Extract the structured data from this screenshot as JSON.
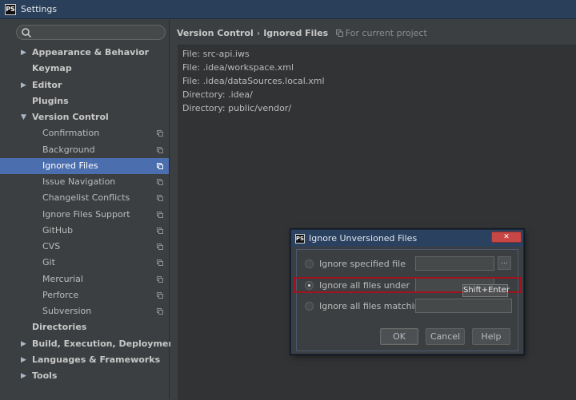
{
  "window": {
    "title": "Settings",
    "logo_text": "PS"
  },
  "search": {
    "placeholder": "",
    "value": ""
  },
  "sidebar": {
    "items": [
      {
        "label": "Appearance & Behavior",
        "level": 1,
        "expandable": true,
        "expanded": false,
        "bold": true
      },
      {
        "label": "Keymap",
        "level": 1,
        "expandable": false,
        "bold": true
      },
      {
        "label": "Editor",
        "level": 1,
        "expandable": true,
        "expanded": false,
        "bold": true
      },
      {
        "label": "Plugins",
        "level": 1,
        "expandable": false,
        "bold": true
      },
      {
        "label": "Version Control",
        "level": 1,
        "expandable": true,
        "expanded": true,
        "bold": true
      },
      {
        "label": "Confirmation",
        "level": 2,
        "copy": true
      },
      {
        "label": "Background",
        "level": 2,
        "copy": true
      },
      {
        "label": "Ignored Files",
        "level": 2,
        "copy": true,
        "selected": true
      },
      {
        "label": "Issue Navigation",
        "level": 2,
        "copy": true
      },
      {
        "label": "Changelist Conflicts",
        "level": 2,
        "copy": true
      },
      {
        "label": "Ignore Files Support",
        "level": 2,
        "copy": true
      },
      {
        "label": "GitHub",
        "level": 2,
        "copy": true
      },
      {
        "label": "CVS",
        "level": 2,
        "copy": true
      },
      {
        "label": "Git",
        "level": 2,
        "copy": true
      },
      {
        "label": "Mercurial",
        "level": 2,
        "copy": true
      },
      {
        "label": "Perforce",
        "level": 2,
        "copy": true
      },
      {
        "label": "Subversion",
        "level": 2,
        "copy": true
      },
      {
        "label": "Directories",
        "level": 1,
        "expandable": false,
        "bold": true
      },
      {
        "label": "Build, Execution, Deployment",
        "level": 1,
        "expandable": true,
        "expanded": false,
        "bold": true
      },
      {
        "label": "Languages & Frameworks",
        "level": 1,
        "expandable": true,
        "expanded": false,
        "bold": true
      },
      {
        "label": "Tools",
        "level": 1,
        "expandable": true,
        "expanded": false,
        "bold": true
      }
    ]
  },
  "breadcrumb": {
    "parent": "Version Control",
    "separator": "›",
    "current": "Ignored Files",
    "scope": "For current project"
  },
  "ignored_list": [
    "File: src-api.iws",
    "File: .idea/workspace.xml",
    "File: .idea/dataSources.local.xml",
    "Directory: .idea/",
    "Directory: public/vendor/"
  ],
  "dialog": {
    "title": "Ignore Unversioned Files",
    "close_label": "✕",
    "options": [
      {
        "label": "Ignore specified file",
        "checked": false
      },
      {
        "label": "Ignore all files under",
        "checked": true
      },
      {
        "label": "Ignore all files matching",
        "checked": false
      }
    ],
    "browse_label": "...",
    "tooltip": "Shift+Enter",
    "buttons": {
      "ok": "OK",
      "cancel": "Cancel",
      "help": "Help"
    }
  },
  "colors": {
    "background": "#3c3f41",
    "selection": "#4b6eaf",
    "titlebar": "#2a3f5a",
    "highlight": "#a0131f"
  }
}
